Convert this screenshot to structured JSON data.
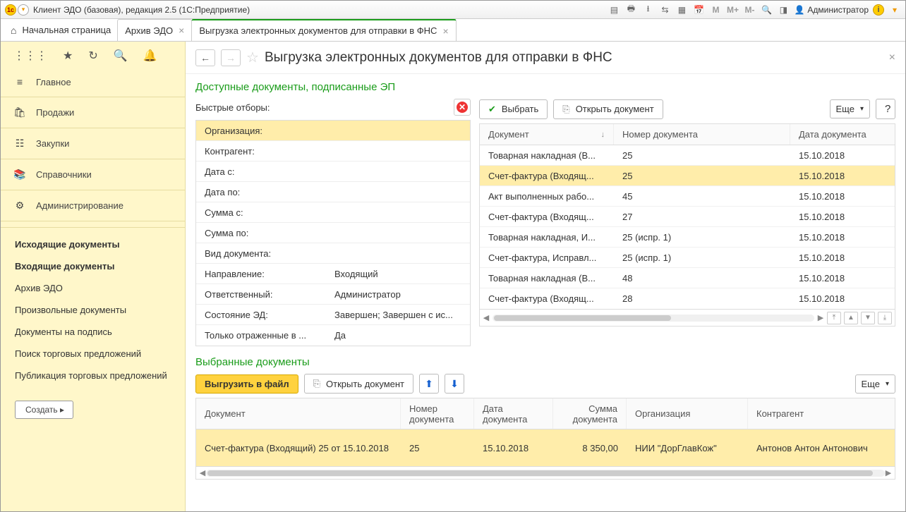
{
  "titlebar": {
    "title": "Клиент ЭДО (базовая), редакция 2.5  (1С:Предприятие)",
    "m1": "M",
    "m2": "M+",
    "m3": "M-",
    "user": "Администратор"
  },
  "tabs": {
    "home": "Начальная страница",
    "t1": "Архив ЭДО",
    "t2": "Выгрузка электронных документов для отправки в ФНС"
  },
  "sidebar": {
    "main": [
      {
        "icon": "≡",
        "label": "Главное"
      },
      {
        "icon": "🛍",
        "label": "Продажи"
      },
      {
        "icon": "☷",
        "label": "Закупки"
      },
      {
        "icon": "📚",
        "label": "Справочники"
      },
      {
        "icon": "⚙",
        "label": "Администрирование"
      }
    ],
    "sub": [
      {
        "label": "Исходящие документы",
        "bold": true
      },
      {
        "label": "Входящие документы",
        "bold": true
      },
      {
        "label": "Архив ЭДО",
        "bold": false
      },
      {
        "label": "Произвольные документы",
        "bold": false
      },
      {
        "label": "Документы на подпись",
        "bold": false
      },
      {
        "label": "Поиск торговых предложений",
        "bold": false
      },
      {
        "label": "Публикация торговых предложений",
        "bold": false
      }
    ],
    "create": "Создать  ▸"
  },
  "page": {
    "title": "Выгрузка электронных документов для отправки в ФНС"
  },
  "available": {
    "title": "Доступные документы, подписанные ЭП",
    "filter_label": "Быстрые отборы:",
    "filters": [
      {
        "k": "Организация:",
        "v": "",
        "hi": true
      },
      {
        "k": "Контрагент:",
        "v": ""
      },
      {
        "k": "Дата с:",
        "v": ""
      },
      {
        "k": "Дата по:",
        "v": ""
      },
      {
        "k": "Сумма с:",
        "v": ""
      },
      {
        "k": "Сумма по:",
        "v": ""
      },
      {
        "k": "Вид документа:",
        "v": ""
      },
      {
        "k": "Направление:",
        "v": "Входящий"
      },
      {
        "k": "Ответственный:",
        "v": "Администратор"
      },
      {
        "k": "Состояние ЭД:",
        "v": "Завершен; Завершен с ис..."
      },
      {
        "k": "Только отраженные в ...",
        "v": "Да"
      }
    ],
    "toolbar": {
      "select": "Выбрать",
      "open": "Открыть документ",
      "more": "Еще"
    },
    "columns": {
      "c1": "Документ",
      "c2": "Номер документа",
      "c3": "Дата документа"
    },
    "rows": [
      {
        "c1": "Товарная накладная (В...",
        "c2": "25",
        "c3": "15.10.2018",
        "sel": false
      },
      {
        "c1": "Счет-фактура (Входящ...",
        "c2": "25",
        "c3": "15.10.2018",
        "sel": true
      },
      {
        "c1": "Акт выполненных рабо...",
        "c2": "45",
        "c3": "15.10.2018",
        "sel": false
      },
      {
        "c1": "Счет-фактура (Входящ...",
        "c2": "27",
        "c3": "15.10.2018",
        "sel": false
      },
      {
        "c1": "Товарная накладная, И...",
        "c2": "25 (испр. 1)",
        "c3": "15.10.2018",
        "sel": false
      },
      {
        "c1": "Счет-фактура, Исправл...",
        "c2": "25 (испр. 1)",
        "c3": "15.10.2018",
        "sel": false
      },
      {
        "c1": "Товарная накладная (В...",
        "c2": "48",
        "c3": "15.10.2018",
        "sel": false
      },
      {
        "c1": "Счет-фактура (Входящ...",
        "c2": "28",
        "c3": "15.10.2018",
        "sel": false
      }
    ]
  },
  "selected": {
    "title": "Выбранные документы",
    "toolbar": {
      "export": "Выгрузить в файл",
      "open": "Открыть документ",
      "more": "Еще"
    },
    "columns": {
      "c1": "Документ",
      "c2": "Номер документа",
      "c3": "Дата документа",
      "c4": "Сумма документа",
      "c5": "Организация",
      "c6": "Контрагент"
    },
    "rows": [
      {
        "c1": "Счет-фактура (Входящий) 25 от 15.10.2018",
        "c2": "25",
        "c3": "15.10.2018",
        "c4": "8 350,00",
        "c5": "НИИ \"ДорГлавКож\"",
        "c6": "Антонов Антон Антонович"
      }
    ]
  }
}
